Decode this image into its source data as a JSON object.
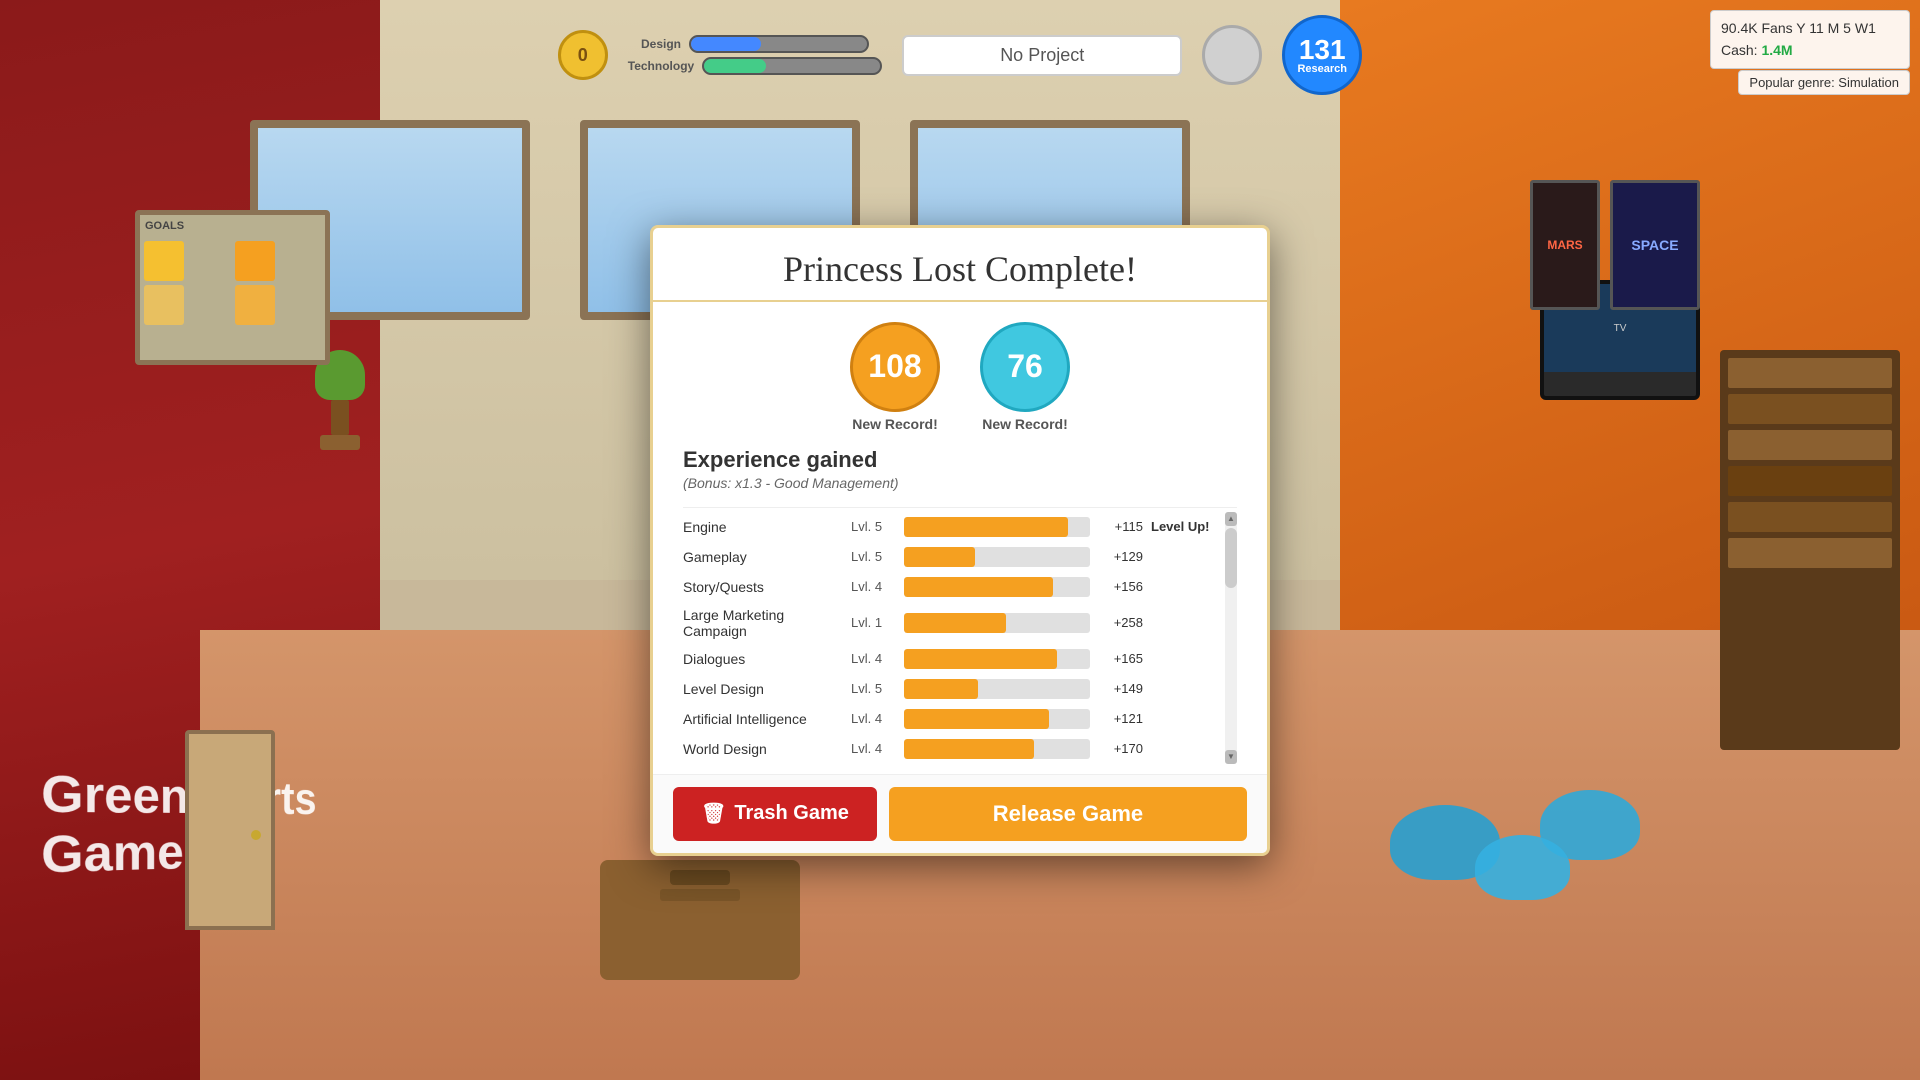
{
  "hud": {
    "coin_value": "0",
    "project_label": "No Project",
    "design_label": "Design",
    "tech_label": "Technology",
    "research_count": "131",
    "research_label": "Research"
  },
  "stats": {
    "fans_info": "90.4K Fans Y 11 M 5 W1",
    "cash_label": "Cash:",
    "cash_value": "1.4M",
    "popular_genre": "Popular genre: Simulation"
  },
  "modal": {
    "title": "Princess Lost Complete!",
    "score_orange": "108",
    "score_blue": "76",
    "record_label_1": "New Record!",
    "record_label_2": "New Record!",
    "experience_title": "Experience gained",
    "experience_bonus": "(Bonus: x1.3 - Good Management)",
    "skills": [
      {
        "name": "Engine",
        "level": "Lvl. 5",
        "bar_pct": 88,
        "bar2_pct": 0,
        "xp": "+115",
        "levelup": "Level Up!"
      },
      {
        "name": "Gameplay",
        "level": "Lvl. 5",
        "bar_pct": 38,
        "bar2_pct": 0,
        "xp": "+129",
        "levelup": ""
      },
      {
        "name": "Story/Quests",
        "level": "Lvl. 4",
        "bar_pct": 80,
        "bar2_pct": 0,
        "xp": "+156",
        "levelup": ""
      },
      {
        "name": "Large Marketing Campaign",
        "level": "Lvl. 1",
        "bar_pct": 55,
        "bar2_pct": 0,
        "xp": "+258",
        "levelup": ""
      },
      {
        "name": "Dialogues",
        "level": "Lvl. 4",
        "bar_pct": 82,
        "bar2_pct": 0,
        "xp": "+165",
        "levelup": ""
      },
      {
        "name": "Level Design",
        "level": "Lvl. 5",
        "bar_pct": 40,
        "bar2_pct": 0,
        "xp": "+149",
        "levelup": ""
      },
      {
        "name": "Artificial Intelligence",
        "level": "Lvl. 4",
        "bar_pct": 78,
        "bar2_pct": 0,
        "xp": "+121",
        "levelup": ""
      },
      {
        "name": "World Design",
        "level": "Lvl. 4",
        "bar_pct": 70,
        "bar2_pct": 0,
        "xp": "+170",
        "levelup": ""
      }
    ],
    "trash_btn": "Trash Game",
    "release_btn": "Release Game"
  }
}
